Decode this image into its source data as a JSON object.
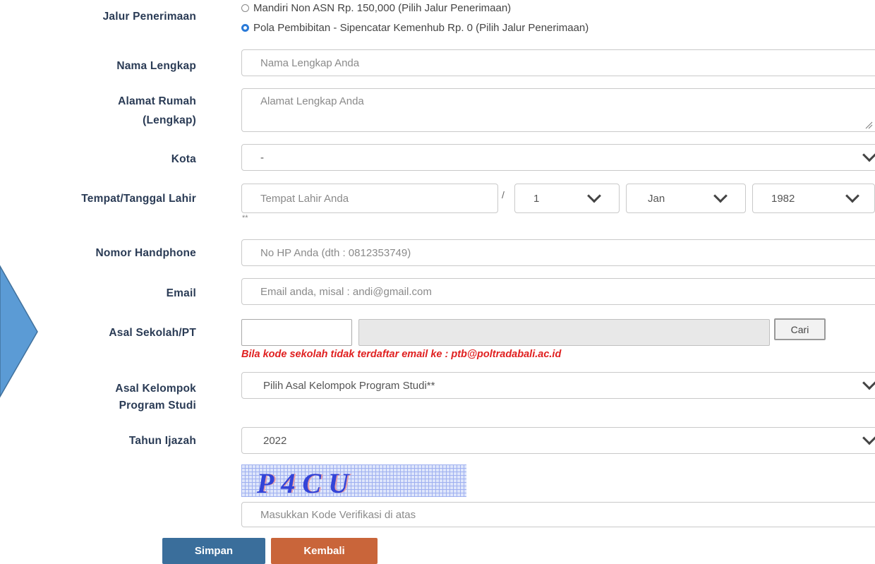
{
  "form": {
    "jalur": {
      "label": "Jalur Penerimaan",
      "options": [
        {
          "label": "Mandiri Non ASN Rp. 150,000 (Pilih Jalur Penerimaan)",
          "checked": false
        },
        {
          "label": "Pola Pembibitan - Sipencatar Kemenhub Rp. 0 (Pilih Jalur Penerimaan)",
          "checked": true
        }
      ]
    },
    "nama": {
      "label": "Nama Lengkap",
      "placeholder": "Nama Lengkap Anda"
    },
    "alamat": {
      "label_line1": "Alamat Rumah",
      "label_line2": "(Lengkap)",
      "placeholder": "Alamat Lengkap Anda"
    },
    "kota": {
      "label": "Kota",
      "value": "-"
    },
    "ttl": {
      "label": "Tempat/Tanggal Lahir",
      "tempat_placeholder": "Tempat Lahir Anda",
      "separator": "/",
      "day": "1",
      "month": "Jan",
      "year": "1982",
      "note": "**"
    },
    "hp": {
      "label": "Nomor Handphone",
      "placeholder": "No HP Anda (dth : 0812353749)"
    },
    "email": {
      "label": "Email",
      "placeholder": "Email anda, misal : andi@gmail.com"
    },
    "sekolah": {
      "label": "Asal Sekolah/PT",
      "cari_label": "Cari",
      "warning": "Bila kode sekolah tidak terdaftar email ke : ptb@poltradabali.ac.id"
    },
    "kelompok": {
      "label_line1": "Asal Kelompok",
      "label_line2": "Program Studi",
      "value": "Pilih Asal Kelompok Program Studi**"
    },
    "tahun": {
      "label": "Tahun Ijazah",
      "value": "2022"
    },
    "captcha": {
      "text": "P4CU",
      "placeholder": "Masukkan Kode Verifikasi di atas"
    },
    "buttons": {
      "simpan": "Simpan",
      "kembali": "Kembali"
    }
  },
  "colors": {
    "arrow": "#5b9bd5",
    "simpan": "#3a6e9b",
    "kembali": "#c9653a",
    "warning": "#e02020",
    "radio_checked": "#2a7ad8"
  }
}
